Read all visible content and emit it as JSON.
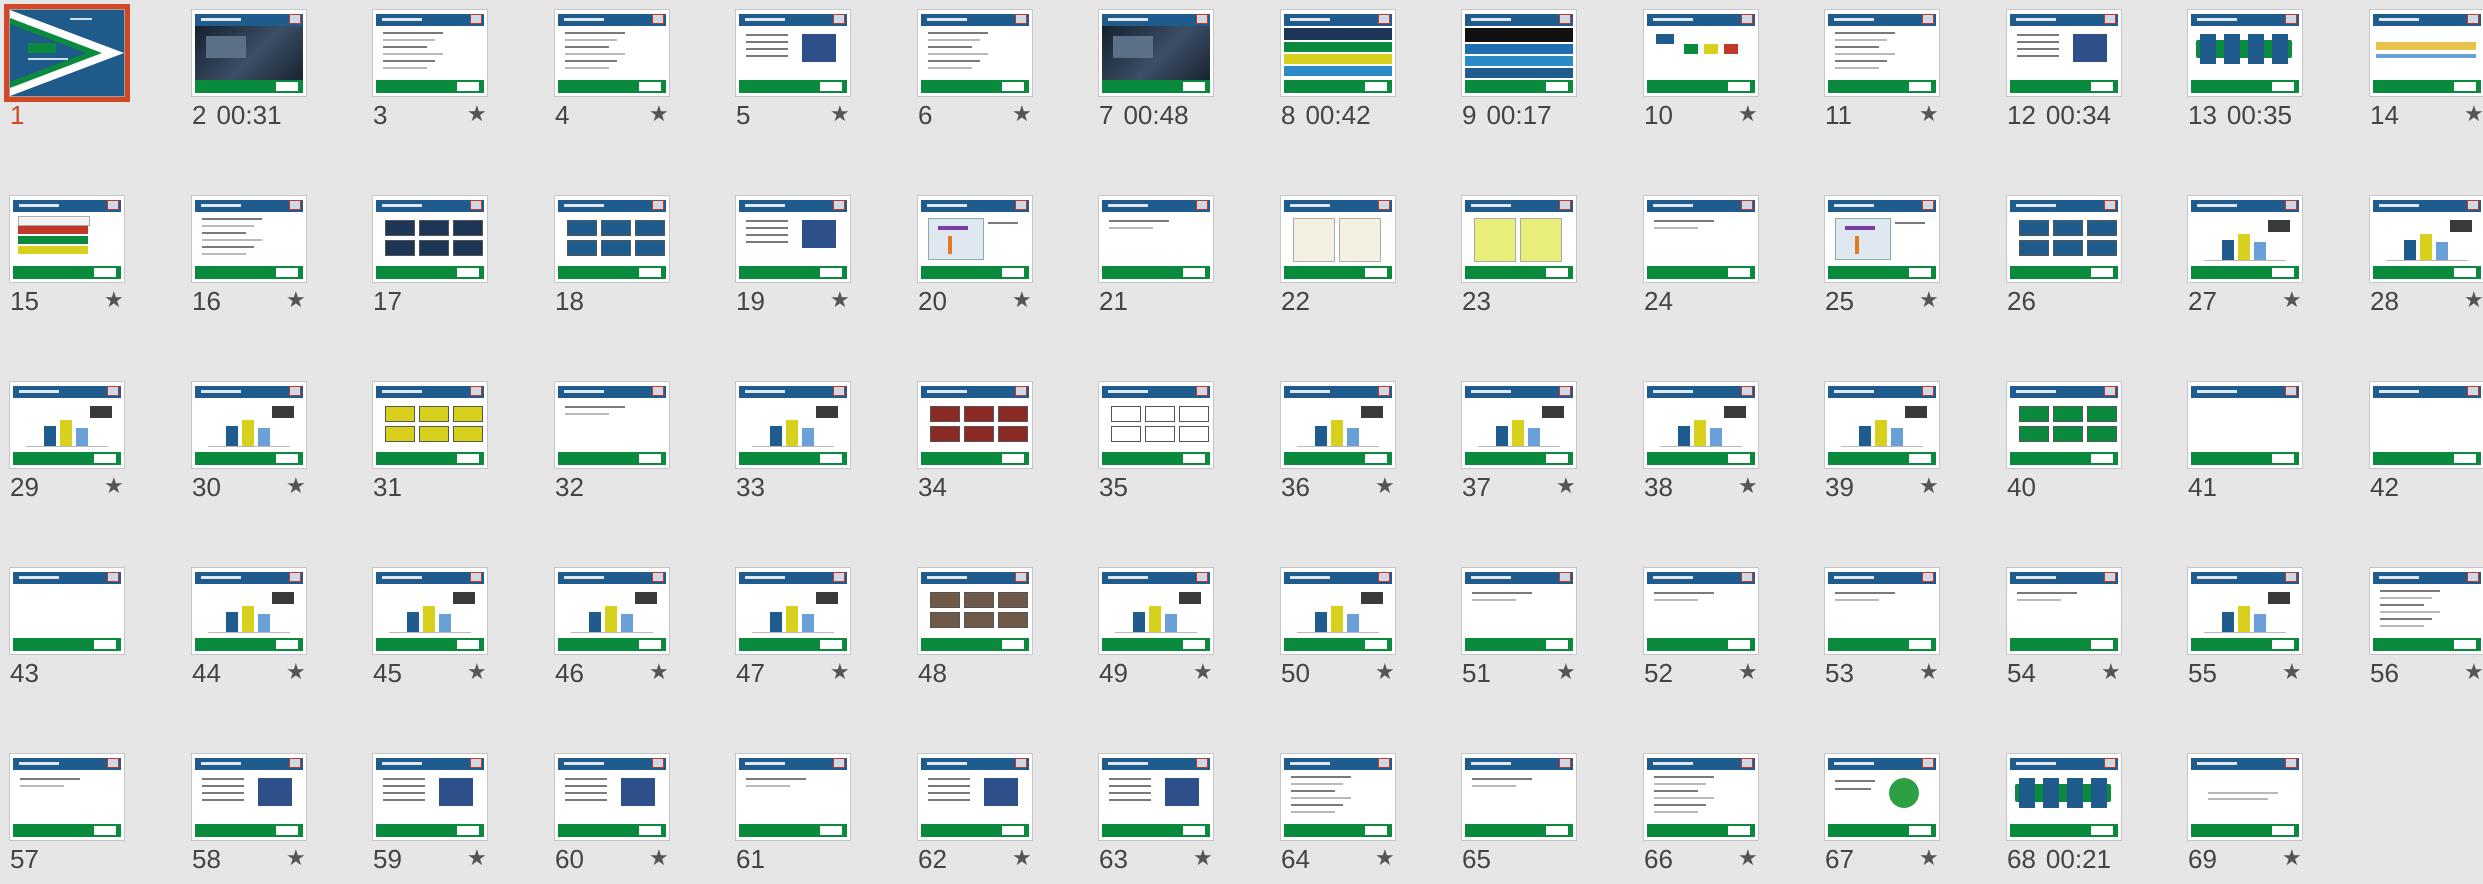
{
  "accent_selected": "#d24726",
  "star_icon": "★",
  "slides": [
    {
      "n": "1",
      "timing": "",
      "star": false,
      "selected": true,
      "kind": "title"
    },
    {
      "n": "2",
      "timing": "00:31",
      "star": false,
      "kind": "dark"
    },
    {
      "n": "3",
      "timing": "",
      "star": true,
      "kind": "list"
    },
    {
      "n": "4",
      "timing": "",
      "star": true,
      "kind": "list"
    },
    {
      "n": "5",
      "timing": "",
      "star": true,
      "kind": "text-pic"
    },
    {
      "n": "6",
      "timing": "",
      "star": true,
      "kind": "list"
    },
    {
      "n": "7",
      "timing": "00:48",
      "star": false,
      "kind": "dark"
    },
    {
      "n": "8",
      "timing": "00:42",
      "star": false,
      "kind": "bands"
    },
    {
      "n": "9",
      "timing": "00:17",
      "star": false,
      "kind": "bands2"
    },
    {
      "n": "10",
      "timing": "",
      "star": true,
      "kind": "diagram"
    },
    {
      "n": "11",
      "timing": "",
      "star": true,
      "kind": "list"
    },
    {
      "n": "12",
      "timing": "00:34",
      "star": false,
      "kind": "text-pic"
    },
    {
      "n": "13",
      "timing": "00:35",
      "star": false,
      "kind": "flow"
    },
    {
      "n": "14",
      "timing": "",
      "star": true,
      "kind": "timeline"
    },
    {
      "n": "15",
      "timing": "",
      "star": true,
      "kind": "stack"
    },
    {
      "n": "16",
      "timing": "",
      "star": true,
      "kind": "list"
    },
    {
      "n": "17",
      "timing": "",
      "star": false,
      "kind": "boxes-dark"
    },
    {
      "n": "18",
      "timing": "",
      "star": false,
      "kind": "boxes-blue"
    },
    {
      "n": "19",
      "timing": "",
      "star": true,
      "kind": "text-pic"
    },
    {
      "n": "20",
      "timing": "",
      "star": true,
      "kind": "map"
    },
    {
      "n": "21",
      "timing": "",
      "star": false,
      "kind": "text"
    },
    {
      "n": "22",
      "timing": "",
      "star": false,
      "kind": "docs"
    },
    {
      "n": "23",
      "timing": "",
      "star": false,
      "kind": "docs-yellow"
    },
    {
      "n": "24",
      "timing": "",
      "star": false,
      "kind": "text"
    },
    {
      "n": "25",
      "timing": "",
      "star": true,
      "kind": "map"
    },
    {
      "n": "26",
      "timing": "",
      "star": false,
      "kind": "boxes-blue"
    },
    {
      "n": "27",
      "timing": "",
      "star": true,
      "kind": "bar"
    },
    {
      "n": "28",
      "timing": "",
      "star": true,
      "kind": "bar"
    },
    {
      "n": "29",
      "timing": "",
      "star": true,
      "kind": "bar"
    },
    {
      "n": "30",
      "timing": "",
      "star": true,
      "kind": "bar"
    },
    {
      "n": "31",
      "timing": "",
      "star": false,
      "kind": "boxes-yellow"
    },
    {
      "n": "32",
      "timing": "",
      "star": false,
      "kind": "text"
    },
    {
      "n": "33",
      "timing": "",
      "star": false,
      "kind": "bar"
    },
    {
      "n": "34",
      "timing": "",
      "star": false,
      "kind": "boxes-red"
    },
    {
      "n": "35",
      "timing": "",
      "star": false,
      "kind": "boxes-white"
    },
    {
      "n": "36",
      "timing": "",
      "star": true,
      "kind": "bar"
    },
    {
      "n": "37",
      "timing": "",
      "star": true,
      "kind": "bar"
    },
    {
      "n": "38",
      "timing": "",
      "star": true,
      "kind": "bar"
    },
    {
      "n": "39",
      "timing": "",
      "star": true,
      "kind": "bar"
    },
    {
      "n": "40",
      "timing": "",
      "star": false,
      "kind": "boxes-green"
    },
    {
      "n": "41",
      "timing": "",
      "star": false,
      "kind": "blank"
    },
    {
      "n": "42",
      "timing": "",
      "star": false,
      "kind": "blank"
    },
    {
      "n": "43",
      "timing": "",
      "star": false,
      "kind": "blank"
    },
    {
      "n": "44",
      "timing": "",
      "star": true,
      "kind": "bar"
    },
    {
      "n": "45",
      "timing": "",
      "star": true,
      "kind": "bar"
    },
    {
      "n": "46",
      "timing": "",
      "star": true,
      "kind": "bar"
    },
    {
      "n": "47",
      "timing": "",
      "star": true,
      "kind": "bar"
    },
    {
      "n": "48",
      "timing": "",
      "star": false,
      "kind": "boxes-brown"
    },
    {
      "n": "49",
      "timing": "",
      "star": true,
      "kind": "bar"
    },
    {
      "n": "50",
      "timing": "",
      "star": true,
      "kind": "bar"
    },
    {
      "n": "51",
      "timing": "",
      "star": true,
      "kind": "text"
    },
    {
      "n": "52",
      "timing": "",
      "star": true,
      "kind": "text"
    },
    {
      "n": "53",
      "timing": "",
      "star": true,
      "kind": "text"
    },
    {
      "n": "54",
      "timing": "",
      "star": true,
      "kind": "text"
    },
    {
      "n": "55",
      "timing": "",
      "star": true,
      "kind": "bar"
    },
    {
      "n": "56",
      "timing": "",
      "star": true,
      "kind": "list"
    },
    {
      "n": "57",
      "timing": "",
      "star": false,
      "kind": "text"
    },
    {
      "n": "58",
      "timing": "",
      "star": true,
      "kind": "text-pic"
    },
    {
      "n": "59",
      "timing": "",
      "star": true,
      "kind": "text-pic"
    },
    {
      "n": "60",
      "timing": "",
      "star": true,
      "kind": "text-pic"
    },
    {
      "n": "61",
      "timing": "",
      "star": false,
      "kind": "text"
    },
    {
      "n": "62",
      "timing": "",
      "star": true,
      "kind": "text-pic"
    },
    {
      "n": "63",
      "timing": "",
      "star": true,
      "kind": "text-pic"
    },
    {
      "n": "64",
      "timing": "",
      "star": true,
      "kind": "list"
    },
    {
      "n": "65",
      "timing": "",
      "star": false,
      "kind": "text"
    },
    {
      "n": "66",
      "timing": "",
      "star": true,
      "kind": "list"
    },
    {
      "n": "67",
      "timing": "",
      "star": true,
      "kind": "check"
    },
    {
      "n": "68",
      "timing": "00:21",
      "star": false,
      "kind": "flow"
    },
    {
      "n": "69",
      "timing": "",
      "star": true,
      "kind": "lines-only"
    }
  ]
}
